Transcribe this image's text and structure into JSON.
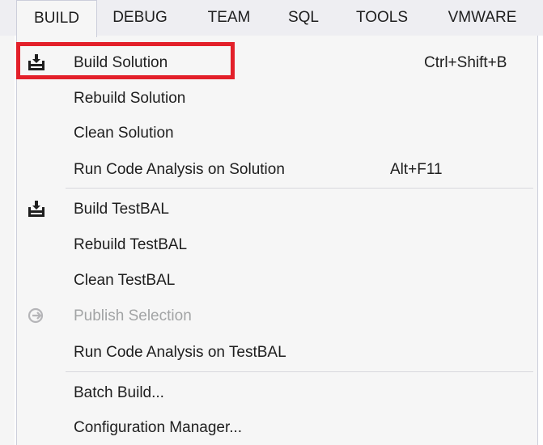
{
  "menubar": {
    "items": [
      {
        "label": "BUILD",
        "active": true
      },
      {
        "label": "DEBUG"
      },
      {
        "label": "TEAM"
      },
      {
        "label": "SQL"
      },
      {
        "label": "TOOLS"
      },
      {
        "label": "VMWARE"
      }
    ]
  },
  "build_menu": {
    "items": [
      {
        "label": "Build Solution",
        "shortcut": "Ctrl+Shift+B",
        "icon": "build-icon",
        "highlighted": true
      },
      {
        "label": "Rebuild Solution"
      },
      {
        "label": "Clean Solution"
      },
      {
        "label": "Run Code Analysis on Solution",
        "shortcut": "Alt+F11"
      },
      {
        "label": "Build TestBAL",
        "icon": "build-icon"
      },
      {
        "label": "Rebuild TestBAL"
      },
      {
        "label": "Clean TestBAL"
      },
      {
        "label": "Publish Selection",
        "icon": "publish-icon",
        "disabled": true
      },
      {
        "label": "Run Code Analysis on TestBAL"
      },
      {
        "label": "Batch Build..."
      },
      {
        "label": "Configuration Manager..."
      }
    ]
  },
  "colors": {
    "menubar_bg": "#eeeef2",
    "menu_bg": "#f6f6f6",
    "highlight_border": "#e3202a",
    "disabled_text": "#a2a4a5"
  }
}
